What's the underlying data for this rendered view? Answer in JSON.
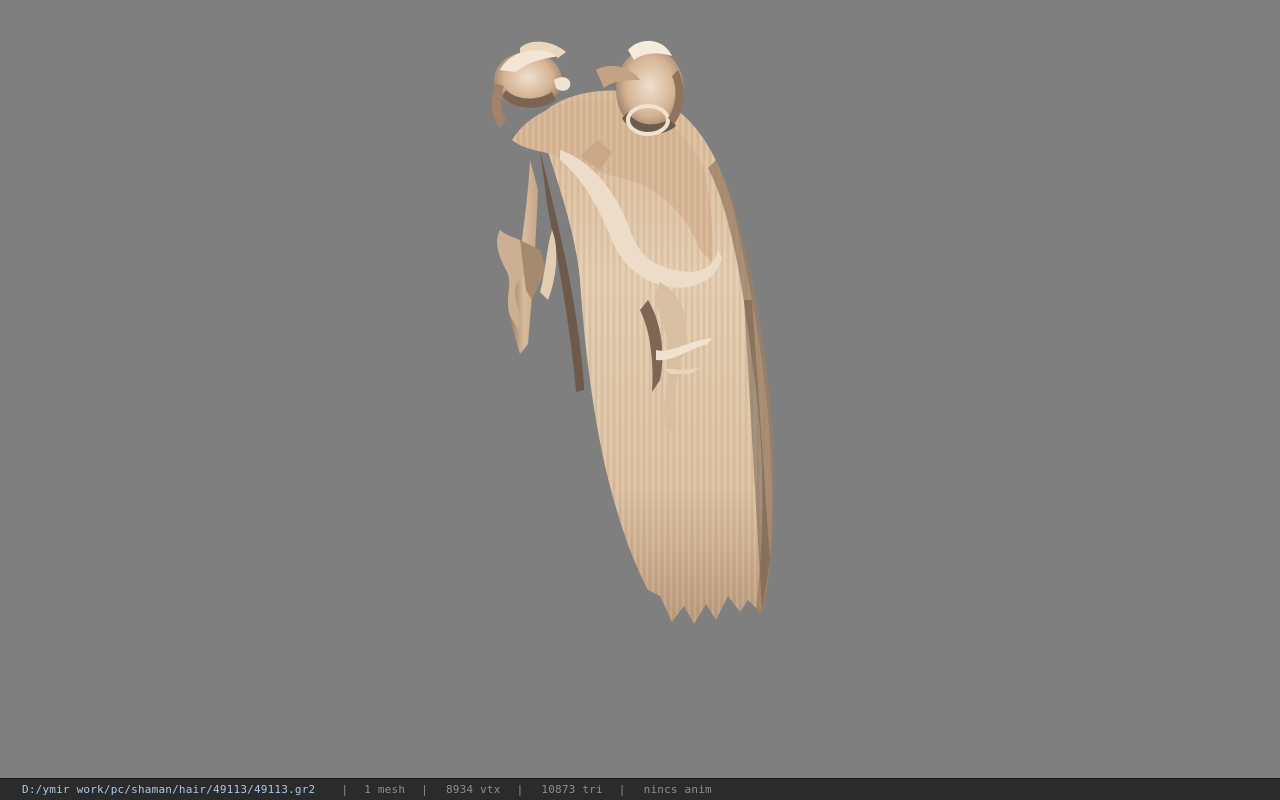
{
  "viewport": {
    "background": "#7f7f7f",
    "model_icon": "hair-model-icon",
    "hair_colors": {
      "light": "#e8d2b8",
      "mid": "#d2b08e",
      "shadow": "#8a6f58",
      "dark": "#5e5046"
    }
  },
  "statusbar": {
    "file_path": "D:/ymir work/pc/shaman/hair/49113/49113.gr2",
    "separator": "|",
    "mesh_count": "1 mesh",
    "vertex_count": "8934 vtx",
    "triangle_count": "10873 tri",
    "anim_status": "nincs anim"
  }
}
